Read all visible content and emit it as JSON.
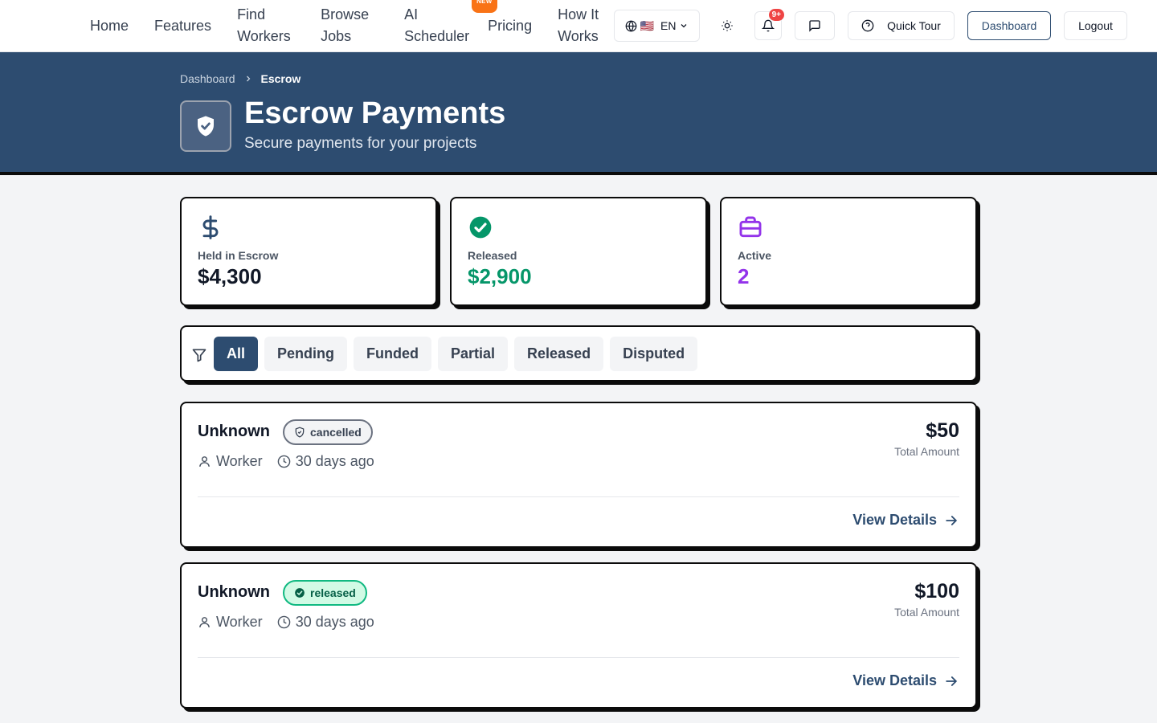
{
  "nav": {
    "links": [
      {
        "id": "home",
        "label": "Home"
      },
      {
        "id": "features",
        "label": "Features"
      },
      {
        "id": "find-workers",
        "label": "Find Workers"
      },
      {
        "id": "browse-jobs",
        "label": "Browse Jobs"
      },
      {
        "id": "ai-scheduler",
        "label": "AI Scheduler",
        "badge": "NEW"
      },
      {
        "id": "pricing",
        "label": "Pricing"
      },
      {
        "id": "how-it-works",
        "label": "How It Works"
      }
    ],
    "language": {
      "flag": "🇺🇸",
      "code": "EN"
    },
    "notification_count": "9+",
    "quick_tour": "Quick Tour",
    "dashboard": "Dashboard",
    "logout": "Logout"
  },
  "breadcrumb": {
    "parent": "Dashboard",
    "current": "Escrow"
  },
  "header": {
    "title": "Escrow Payments",
    "subtitle": "Secure payments for your projects"
  },
  "stats": [
    {
      "label": "Held in Escrow",
      "value": "$4,300",
      "icon": "dollar-icon",
      "color": "#111827"
    },
    {
      "label": "Released",
      "value": "$2,900",
      "icon": "check-circle-icon",
      "color": "#059669"
    },
    {
      "label": "Active",
      "value": "2",
      "icon": "briefcase-icon",
      "color": "#9333ea"
    }
  ],
  "filters": {
    "active": "All",
    "options": [
      "All",
      "Pending",
      "Funded",
      "Partial",
      "Released",
      "Disputed"
    ]
  },
  "escrows": [
    {
      "title": "Unknown",
      "status": "cancelled",
      "worker": "Worker",
      "time": "30 days ago",
      "amount": "$50",
      "amount_label": "Total Amount",
      "action": "View Details"
    },
    {
      "title": "Unknown",
      "status": "released",
      "worker": "Worker",
      "time": "30 days ago",
      "amount": "$100",
      "amount_label": "Total Amount",
      "action": "View Details"
    }
  ],
  "colors": {
    "primary": "#2d4c70",
    "released": "#10b981",
    "active": "#9333ea",
    "notification": "#ef4444",
    "new_badge": "#f97316"
  }
}
